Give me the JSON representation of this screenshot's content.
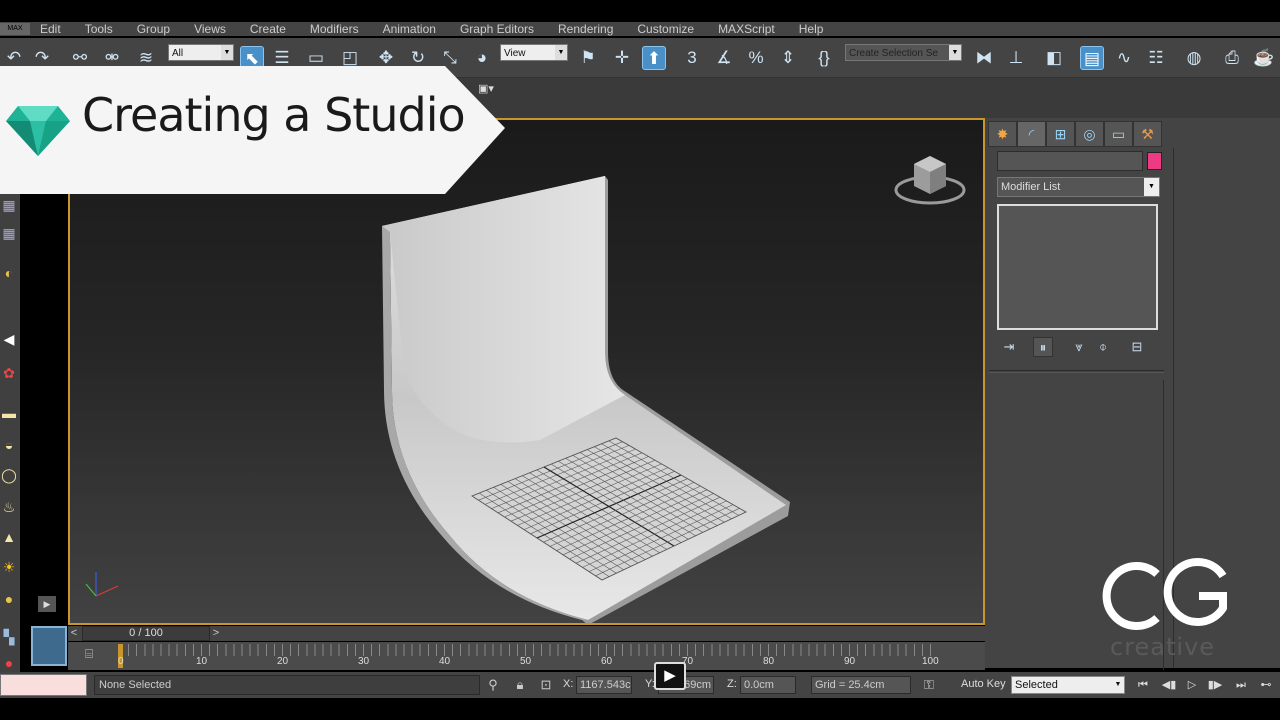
{
  "menu": {
    "logo": "MAX",
    "items": [
      "Edit",
      "Tools",
      "Group",
      "Views",
      "Create",
      "Modifiers",
      "Animation",
      "Graph Editors",
      "Rendering",
      "Customize",
      "MAXScript",
      "Help"
    ]
  },
  "toolbar": {
    "selection_filter": "All",
    "reference_coord": "View",
    "named_selection_placeholder": "Create Selection Se",
    "snaps": {
      "snap_3d": "3",
      "angle_snap": "∡",
      "percent_snap": "%"
    }
  },
  "title_banner": {
    "title": "Creating a Studio",
    "icon": "diamond-gem-icon",
    "accent": "#2bbfa4"
  },
  "command_panel": {
    "tabs": [
      {
        "name": "create",
        "icon": "sun-icon"
      },
      {
        "name": "modify",
        "icon": "curve-icon"
      },
      {
        "name": "hierarchy",
        "icon": "hierarchy-icon"
      },
      {
        "name": "motion",
        "icon": "motion-icon"
      },
      {
        "name": "display",
        "icon": "monitor-icon"
      },
      {
        "name": "utilities",
        "icon": "hammer-icon"
      }
    ],
    "object_color": "#ec3a83",
    "modifier_list": "Modifier List"
  },
  "timeline": {
    "frame_display": "0 / 100",
    "prev_arrow": "<",
    "next_arrow": ">",
    "ruler_labels": [
      "0",
      "10",
      "20",
      "30",
      "40",
      "50",
      "60",
      "70",
      "80",
      "90",
      "100"
    ]
  },
  "status": {
    "message": "None Selected",
    "x_label": "X:",
    "x_value": "1167.543c",
    "y_label": "Y:",
    "y_value": "569cm",
    "z_label": "Z:",
    "z_value": "0.0cm",
    "grid": "Grid = 25.4cm",
    "auto_key": "Auto Key",
    "key_filter": "Selected"
  },
  "watermark": {
    "brand": "CG",
    "caption": "creative"
  },
  "viewport": {
    "background_top": "#1a1a1a",
    "background_bottom": "#424242",
    "border_color": "#c8962a"
  }
}
